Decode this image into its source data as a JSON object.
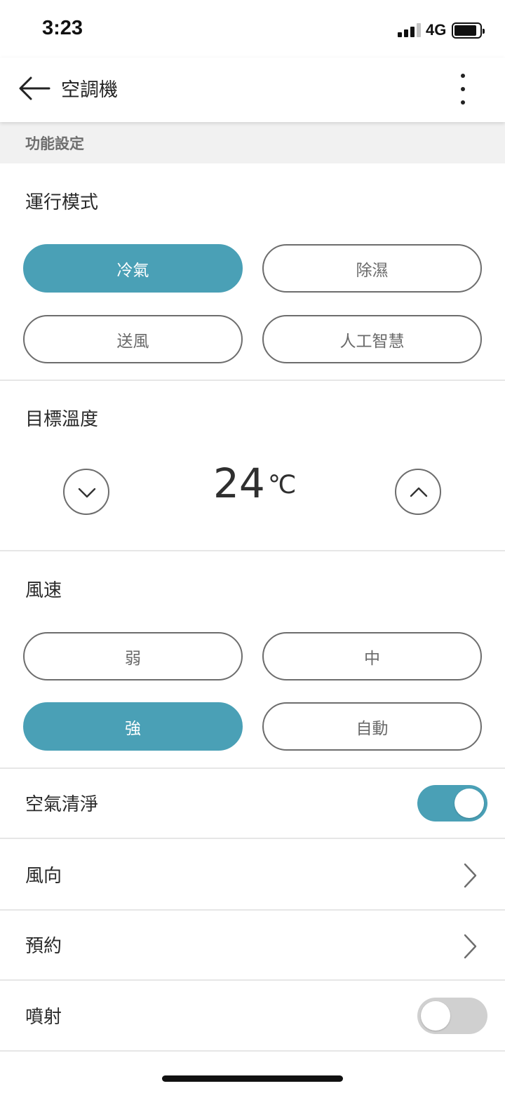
{
  "status_bar": {
    "time": "3:23",
    "network": "4G",
    "icons": [
      "signal-icon",
      "battery-icon"
    ]
  },
  "app_bar": {
    "title": "空調機",
    "icons": [
      "back-arrow-icon",
      "more-vertical-icon"
    ]
  },
  "section_header": "功能設定",
  "operation_mode": {
    "label": "運行模式",
    "options": [
      {
        "label": "冷氣",
        "selected": true
      },
      {
        "label": "除濕",
        "selected": false
      },
      {
        "label": "送風",
        "selected": false
      },
      {
        "label": "人工智慧",
        "selected": false
      }
    ]
  },
  "target_temperature": {
    "label": "目標溫度",
    "value": "24",
    "unit": "℃",
    "icons": [
      "chevron-down-icon",
      "chevron-up-icon"
    ]
  },
  "fan_speed": {
    "label": "風速",
    "options": [
      {
        "label": "弱",
        "selected": false
      },
      {
        "label": "中",
        "selected": false
      },
      {
        "label": "強",
        "selected": true
      },
      {
        "label": "自動",
        "selected": false
      }
    ]
  },
  "settings": [
    {
      "label": "空氣清淨",
      "type": "toggle",
      "on": true
    },
    {
      "label": "風向",
      "type": "link"
    },
    {
      "label": "預約",
      "type": "link"
    },
    {
      "label": "噴射",
      "type": "toggle",
      "on": false
    }
  ],
  "colors": {
    "accent": "#4aa0b6",
    "toggle_off": "#d0d0d0",
    "section_bg": "#f1f1f1",
    "border": "#6d6d6d"
  }
}
